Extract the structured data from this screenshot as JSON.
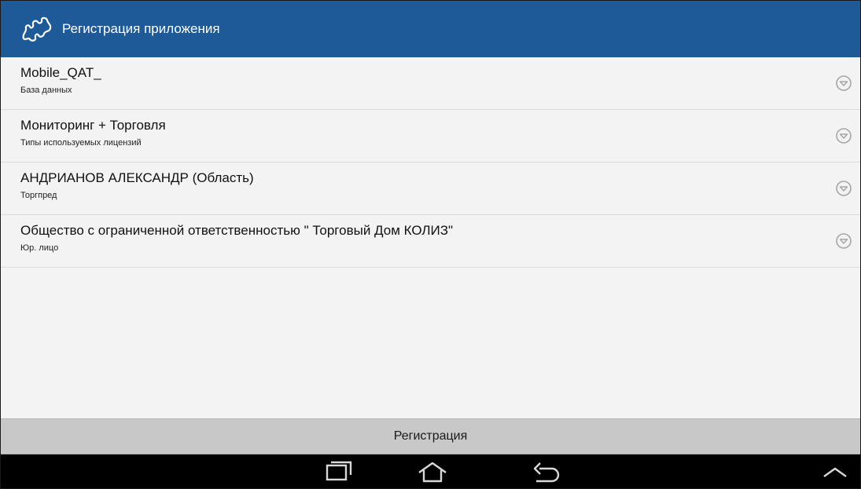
{
  "header": {
    "title": "Регистрация приложения",
    "icon": "puzzle-icon",
    "background": "#1e5a98"
  },
  "rows": [
    {
      "value": "Mobile_QAT_",
      "label": "База данных"
    },
    {
      "value": "Мониторинг + Торговля",
      "label": "Типы используемых лицензий"
    },
    {
      "value": "АНДРИАНОВ АЛЕКСАНДР (Область)",
      "label": "Торгпред"
    },
    {
      "value": "Общество с ограниченной ответственностью \" Торговый Дом КОЛИЗ\"",
      "label": "Юр. лицо"
    }
  ],
  "footer": {
    "register_label": "Регистрация"
  },
  "nav": {
    "buttons": [
      "recent-apps-icon",
      "home-icon",
      "back-icon",
      "chevron-up-icon"
    ]
  }
}
